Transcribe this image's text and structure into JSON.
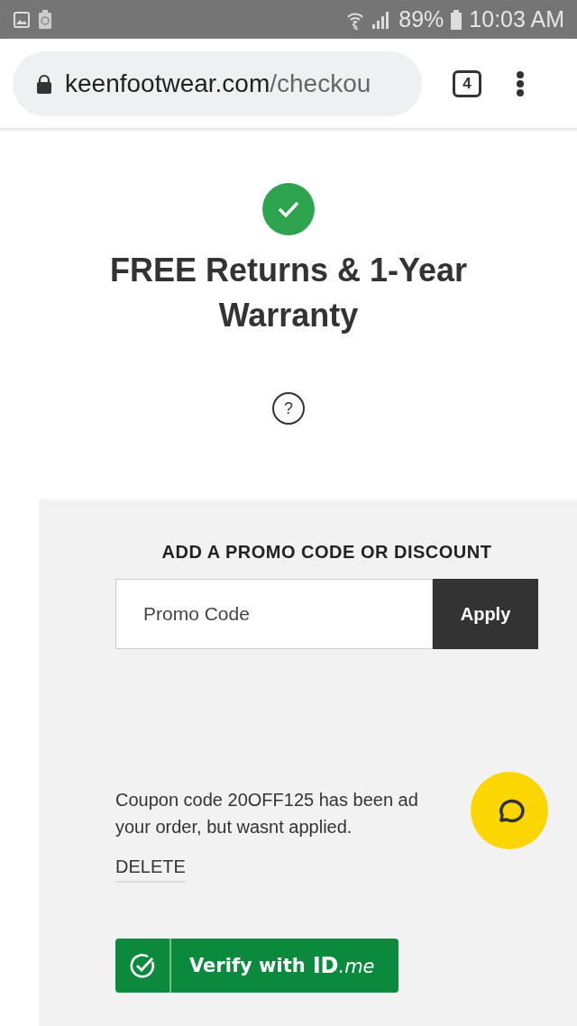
{
  "status_bar": {
    "battery": "89%",
    "time": "10:03 AM"
  },
  "browser": {
    "url_host": "keenfootwear.com",
    "url_path": "/checkou",
    "tab_count": "4"
  },
  "banner": {
    "title": "FREE Returns & 1-Year Warranty",
    "help": "?"
  },
  "promo": {
    "heading": "ADD A PROMO CODE OR DISCOUNT",
    "placeholder": "Promo Code",
    "apply": "Apply",
    "message_lines": [
      "Coupon code 20OFF125 has been ad",
      "your order, but wasnt applied."
    ],
    "delete": "DELETE",
    "verify_label": "Verify with",
    "verify_logo": "ID",
    "verify_logo_suffix": ".me"
  }
}
